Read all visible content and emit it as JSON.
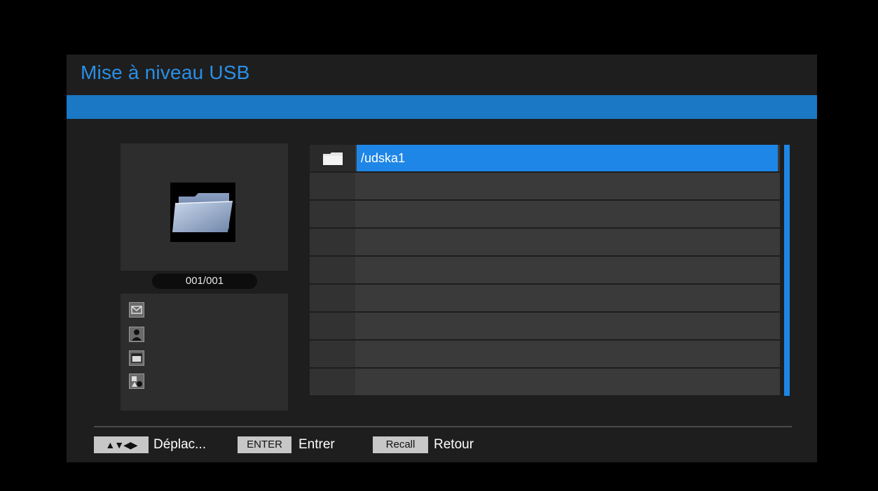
{
  "header": {
    "title": "Mise à niveau USB"
  },
  "preview": {
    "counter": "001/001",
    "icon": "folder-icon"
  },
  "info_icons": [
    "mail-icon",
    "user-icon",
    "card-icon",
    "shapes-icon"
  ],
  "file_list": {
    "rows": [
      {
        "label": "/udska1",
        "icon": "folder-icon",
        "selected": true
      },
      {
        "label": ""
      },
      {
        "label": ""
      },
      {
        "label": ""
      },
      {
        "label": ""
      },
      {
        "label": ""
      },
      {
        "label": ""
      },
      {
        "label": ""
      },
      {
        "label": ""
      }
    ]
  },
  "footer": {
    "move_key": "▲▼◀▶",
    "move_label": "Déplac...",
    "enter_key": "ENTER",
    "enter_label": "Entrer",
    "recall_key": "Recall",
    "recall_label": "Retour"
  },
  "colors": {
    "accent": "#1e86e6",
    "band": "#1a78c4",
    "title": "#2a8fe6"
  }
}
